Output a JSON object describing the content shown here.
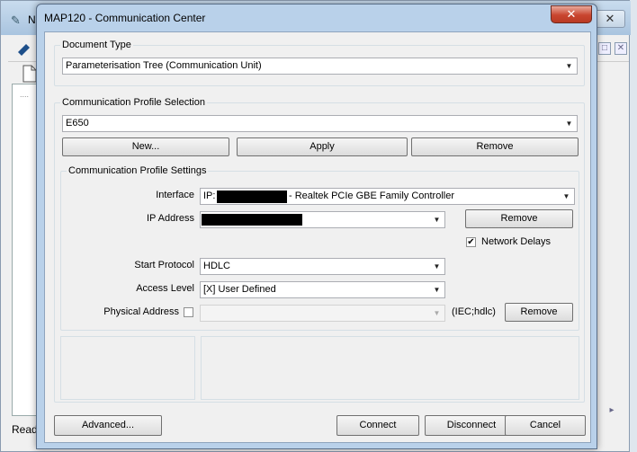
{
  "background_app": {
    "title": "N",
    "status": "Read"
  },
  "dialog": {
    "title": "MAP120 - Communication Center",
    "close_glyph": "✕",
    "document_type": {
      "label": "Document Type",
      "value": "Parameterisation Tree (Communication Unit)"
    },
    "profile_selection": {
      "label": "Communication Profile Selection",
      "value": "E650",
      "new_label": "New...",
      "apply_label": "Apply",
      "remove_label": "Remove"
    },
    "profile_settings": {
      "label": "Communication Profile Settings",
      "interface_label": "Interface",
      "interface_prefix": "IP:",
      "interface_suffix": "- Realtek PCIe GBE Family Controller",
      "ip_address_label": "IP Address",
      "ip_remove_label": "Remove",
      "network_delays_label": "Network Delays",
      "network_delays_checked": true,
      "start_protocol_label": "Start Protocol",
      "start_protocol_value": "HDLC",
      "access_level_label": "Access Level",
      "access_level_value": "[X] User Defined",
      "physical_address_label": "Physical Address",
      "physical_address_checked": false,
      "physical_address_value": "",
      "physical_address_hint": "(IEC;hdlc)",
      "physical_remove_label": "Remove"
    },
    "footer": {
      "advanced_label": "Advanced...",
      "connect_label": "Connect",
      "disconnect_label": "Disconnect",
      "cancel_label": "Cancel"
    }
  }
}
